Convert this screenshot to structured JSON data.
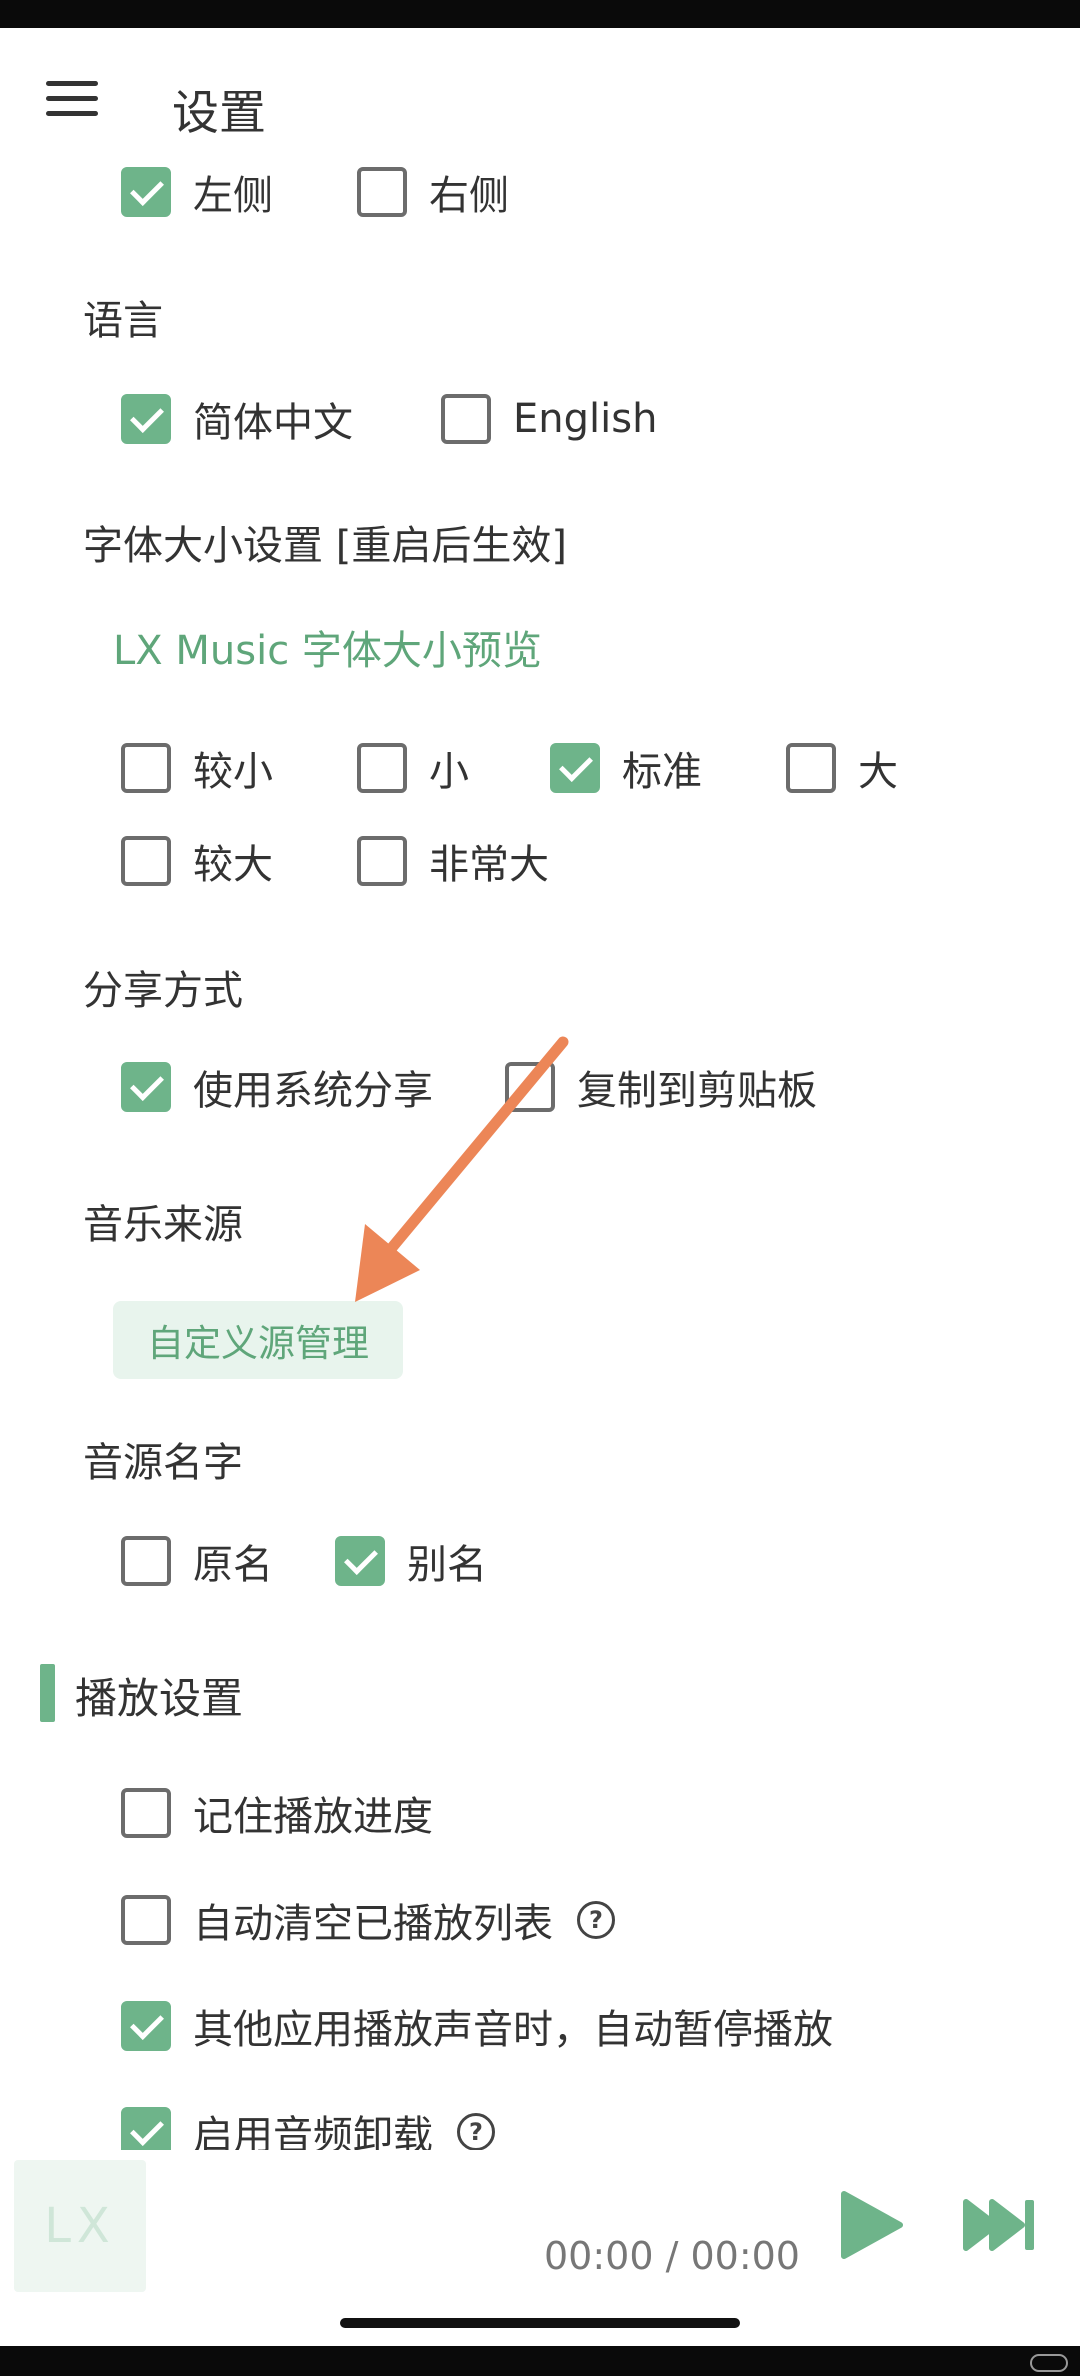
{
  "header": {
    "title": "设置"
  },
  "side_options": [
    {
      "label": "左侧",
      "checked": true
    },
    {
      "label": "右侧",
      "checked": false
    }
  ],
  "language": {
    "label": "语言",
    "options": [
      {
        "label": "简体中文",
        "checked": true
      },
      {
        "label": "English",
        "checked": false
      }
    ]
  },
  "font_size": {
    "label": "字体大小设置 [重启后生效]",
    "preview": "LX Music 字体大小预览",
    "options": [
      {
        "label": "较小",
        "checked": false
      },
      {
        "label": "小",
        "checked": false
      },
      {
        "label": "标准",
        "checked": true
      },
      {
        "label": "大",
        "checked": false
      },
      {
        "label": "较大",
        "checked": false
      },
      {
        "label": "非常大",
        "checked": false
      }
    ]
  },
  "share": {
    "label": "分享方式",
    "options": [
      {
        "label": "使用系统分享",
        "checked": true
      },
      {
        "label": "复制到剪贴板",
        "checked": false
      }
    ]
  },
  "music_source": {
    "label": "音乐来源",
    "button": "自定义源管理"
  },
  "source_name": {
    "label": "音源名字",
    "options": [
      {
        "label": "原名",
        "checked": false
      },
      {
        "label": "别名",
        "checked": true
      }
    ]
  },
  "playback": {
    "header": "播放设置",
    "options": [
      {
        "label": "记住播放进度",
        "checked": false,
        "help": false
      },
      {
        "label": "自动清空已播放列表",
        "checked": false,
        "help": true
      },
      {
        "label": "其他应用播放声音时，自动暂停播放",
        "checked": true,
        "help": false
      },
      {
        "label": "启用音频卸载",
        "checked": true,
        "help": true
      }
    ],
    "help_glyph": "?"
  },
  "player": {
    "logo_text": "LX",
    "time": "00:00 / 00:00"
  },
  "colors": {
    "accent": "#6eb48a",
    "accent_text": "#5fa67a",
    "annotation_arrow": "#ec8657"
  },
  "icons": {
    "menu": "hamburger-menu-icon",
    "play": "play-icon",
    "next": "skip-next-icon",
    "help": "question-circle-icon",
    "check": "checkmark-icon"
  }
}
